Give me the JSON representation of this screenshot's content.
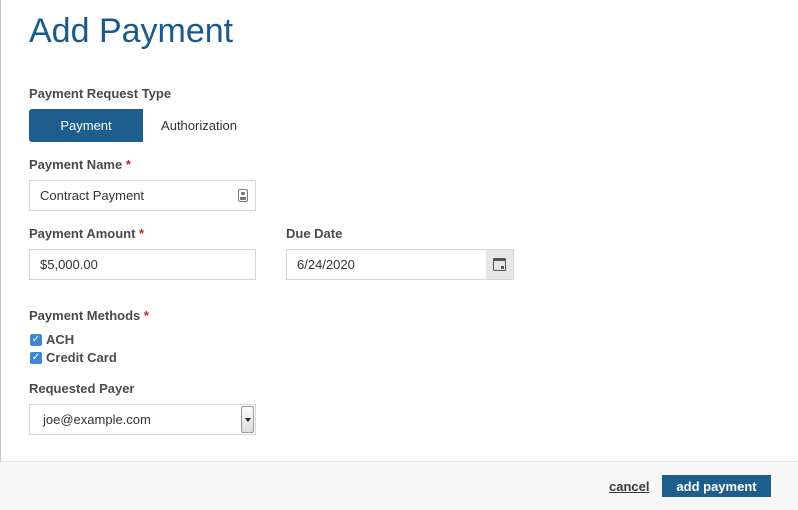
{
  "header": {
    "title": "Add Payment"
  },
  "request_type": {
    "label": "Payment Request Type",
    "options": [
      "Payment",
      "Authorization"
    ],
    "selected": "Payment"
  },
  "payment_name": {
    "label": "Payment Name",
    "required_mark": "*",
    "value": "Contract Payment",
    "icon": "contact-card-icon"
  },
  "payment_amount": {
    "label": "Payment Amount",
    "required_mark": "*",
    "value": "$5,000.00"
  },
  "due_date": {
    "label": "Due Date",
    "value": "6/24/2020",
    "icon": "calendar-icon"
  },
  "payment_methods": {
    "label": "Payment Methods",
    "required_mark": "*",
    "items": [
      {
        "label": "ACH",
        "checked": true
      },
      {
        "label": "Credit Card",
        "checked": true
      }
    ]
  },
  "requested_payer": {
    "label": "Requested Payer",
    "selected": "joe@example.com"
  },
  "footer": {
    "cancel_label": "cancel",
    "submit_label": "add payment"
  },
  "colors": {
    "title": "#1a5a8a",
    "primary_button": "#1d5e8c",
    "checkbox": "#3d88d6",
    "required": "#b0282e"
  }
}
